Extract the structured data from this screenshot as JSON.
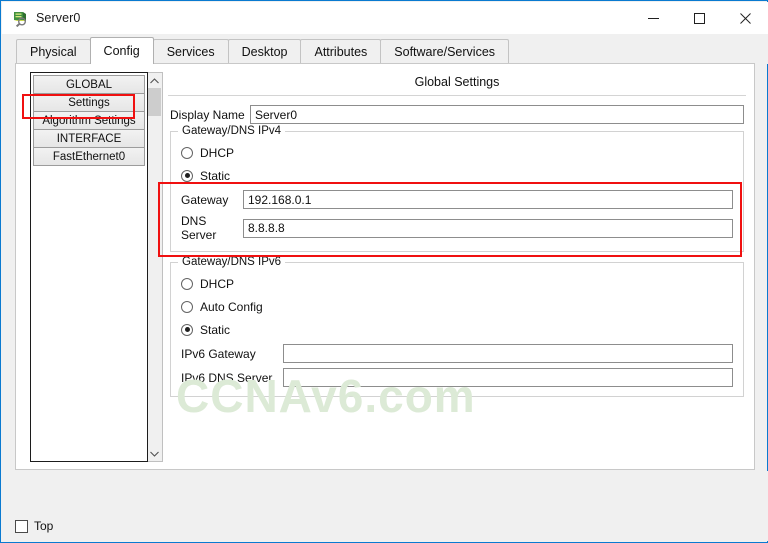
{
  "window": {
    "title": "Server0",
    "icon": "server-device-icon",
    "minimize_label": "Minimize",
    "maximize_label": "Maximize",
    "close_label": "Close",
    "border_color": "#0a7ad0"
  },
  "tabs": [
    {
      "label": "Physical",
      "active": false
    },
    {
      "label": "Config",
      "active": true
    },
    {
      "label": "Services",
      "active": false
    },
    {
      "label": "Desktop",
      "active": false
    },
    {
      "label": "Attributes",
      "active": false
    },
    {
      "label": "Software/Services",
      "active": false
    }
  ],
  "sidebar": {
    "items": [
      {
        "label": "GLOBAL",
        "selected": false
      },
      {
        "label": "Settings",
        "selected": true
      },
      {
        "label": "Algorithm Settings",
        "selected": false
      },
      {
        "label": "INTERFACE",
        "selected": false
      },
      {
        "label": "FastEthernet0",
        "selected": false
      }
    ],
    "scroll_up": "▲",
    "scroll_down": "▼"
  },
  "settings": {
    "panel_title": "Global Settings",
    "display_name_label": "Display Name",
    "display_name_value": "Server0",
    "ipv4": {
      "legend": "Gateway/DNS IPv4",
      "dhcp_label": "DHCP",
      "dhcp_selected": false,
      "static_label": "Static",
      "static_selected": true,
      "gateway_label": "Gateway",
      "gateway_value": "192.168.0.1",
      "dns_label": "DNS Server",
      "dns_value": "8.8.8.8"
    },
    "ipv6": {
      "legend": "Gateway/DNS IPv6",
      "dhcp_label": "DHCP",
      "dhcp_selected": false,
      "autoconfig_label": "Auto Config",
      "autoconfig_selected": false,
      "static_label": "Static",
      "static_selected": true,
      "gateway_label": "IPv6 Gateway",
      "gateway_value": "",
      "dns_label": "IPv6 DNS Server",
      "dns_value": ""
    }
  },
  "watermark": {
    "text": "CCNAv6.com",
    "color": "#dcead6"
  },
  "annotations": {
    "highlight_color": "#f01010",
    "boxes": [
      {
        "name": "settings-sidebar-highlight"
      },
      {
        "name": "ipv4-static-highlight"
      }
    ]
  },
  "footer": {
    "top_checkbox_label": "Top",
    "top_checkbox_checked": false
  }
}
